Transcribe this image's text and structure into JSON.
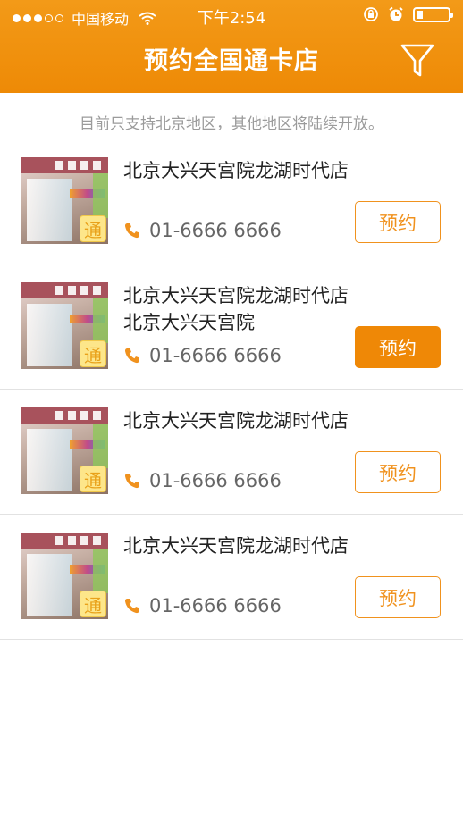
{
  "status_bar": {
    "carrier": "中国移动",
    "time": "下午2:54"
  },
  "header": {
    "title": "预约全国通卡店"
  },
  "notice": "目前只支持北京地区，其他地区将陆续开放。",
  "stores": [
    {
      "name": "北京大兴天宫院龙湖时代店",
      "badge": "通",
      "phone": "01-6666 6666",
      "button": "预约",
      "selected": false
    },
    {
      "name": "北京大兴天宫院龙湖时代店\n北京大兴天宫院",
      "badge": "通",
      "phone": "01-6666 6666",
      "button": "预约",
      "selected": true
    },
    {
      "name": "北京大兴天宫院龙湖时代店",
      "badge": "通",
      "phone": "01-6666 6666",
      "button": "预约",
      "selected": false
    },
    {
      "name": "北京大兴天宫院龙湖时代店",
      "badge": "通",
      "phone": "01-6666 6666",
      "button": "预约",
      "selected": false
    }
  ],
  "colors": {
    "accent": "#ef8806",
    "header_gradient_top": "#f39a18",
    "notice_text": "#9b9b9b"
  }
}
